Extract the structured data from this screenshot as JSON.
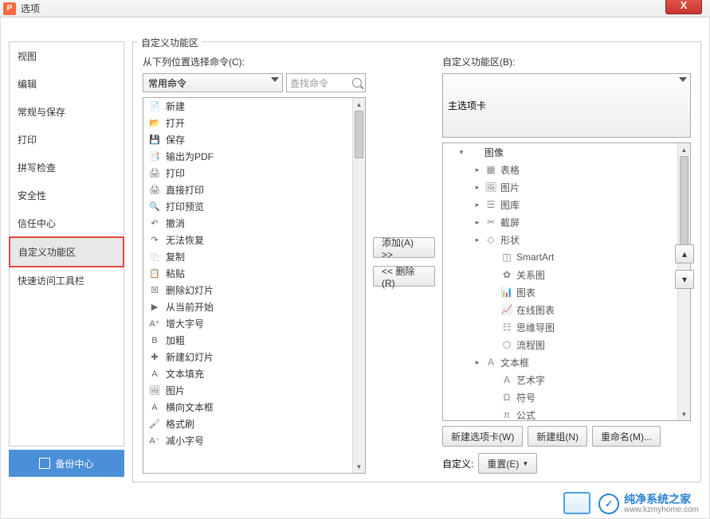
{
  "window": {
    "title": "选项"
  },
  "sidebar": {
    "items": [
      "视图",
      "编辑",
      "常规与保存",
      "打印",
      "拼写检查",
      "安全性",
      "信任中心",
      "自定义功能区",
      "快速访问工具栏"
    ],
    "active_index": 7,
    "backup_label": "备份中心"
  },
  "main": {
    "legend": "自定义功能区",
    "left": {
      "label": "从下列位置选择命令(C):",
      "dropdown": "常用命令",
      "search_placeholder": "查找命令",
      "commands": [
        {
          "icon": "📄",
          "label": "新建"
        },
        {
          "icon": "📂",
          "label": "打开"
        },
        {
          "icon": "💾",
          "label": "保存"
        },
        {
          "icon": "📑",
          "label": "输出为PDF"
        },
        {
          "icon": "🖨",
          "label": "打印"
        },
        {
          "icon": "🖨",
          "label": "直接打印"
        },
        {
          "icon": "🔍",
          "label": "打印预览"
        },
        {
          "icon": "↶",
          "label": "撤消",
          "expand": true
        },
        {
          "icon": "↷",
          "label": "无法恢复"
        },
        {
          "icon": "⿻",
          "label": "复制"
        },
        {
          "icon": "📋",
          "label": "粘贴",
          "expand": true
        },
        {
          "icon": "☒",
          "label": "删除幻灯片"
        },
        {
          "icon": "▶",
          "label": "从当前开始"
        },
        {
          "icon": "A⁺",
          "label": "增大字号"
        },
        {
          "icon": "B",
          "label": "加粗"
        },
        {
          "icon": "✚",
          "label": "新建幻灯片",
          "expand": true
        },
        {
          "icon": "A",
          "label": "文本填充",
          "expand": true
        },
        {
          "icon": "🖼",
          "label": "图片",
          "expand": true
        },
        {
          "icon": "A",
          "label": "横向文本框"
        },
        {
          "icon": "🖌",
          "label": "格式刷"
        },
        {
          "icon": "A⁻",
          "label": "减小字号"
        }
      ]
    },
    "mid": {
      "add_label": "添加(A) >>",
      "remove_label": "<< 删除(R)"
    },
    "right": {
      "label": "自定义功能区(B):",
      "dropdown": "主选项卡",
      "tree": [
        {
          "level": 0,
          "tri": "▾",
          "icon": "",
          "label": "图像"
        },
        {
          "level": 1,
          "tri": "▸",
          "icon": "▦",
          "label": "表格",
          "expand": true
        },
        {
          "level": 1,
          "tri": "▸",
          "icon": "🖼",
          "label": "图片",
          "expand": true
        },
        {
          "level": 1,
          "tri": "▸",
          "icon": "☰",
          "label": "图库",
          "expand": true
        },
        {
          "level": 1,
          "tri": "▸",
          "icon": "✂",
          "label": "截屏",
          "expand": true
        },
        {
          "level": 1,
          "tri": "▸",
          "icon": "◇",
          "label": "形状",
          "expand": true
        },
        {
          "level": 2,
          "tri": "",
          "icon": "◫",
          "label": "SmartArt"
        },
        {
          "level": 2,
          "tri": "",
          "icon": "✿",
          "label": "关系图"
        },
        {
          "level": 2,
          "tri": "",
          "icon": "📊",
          "label": "图表"
        },
        {
          "level": 2,
          "tri": "",
          "icon": "📈",
          "label": "在线图表"
        },
        {
          "level": 2,
          "tri": "",
          "icon": "☷",
          "label": "思维导图"
        },
        {
          "level": 2,
          "tri": "",
          "icon": "⬡",
          "label": "流程图"
        },
        {
          "level": 1,
          "tri": "▸",
          "icon": "A",
          "label": "文本框",
          "expand": true
        },
        {
          "level": 2,
          "tri": "",
          "icon": "A",
          "label": "艺术字"
        },
        {
          "level": 2,
          "tri": "",
          "icon": "Ω",
          "label": "符号",
          "expand": true
        },
        {
          "level": 2,
          "tri": "",
          "icon": "π",
          "label": "公式"
        }
      ],
      "btn_new_tab": "新建选项卡(W)",
      "btn_new_group": "新建组(N)",
      "btn_rename": "重命名(M)...",
      "custom_label": "自定义:",
      "reset_label": "重置(E)"
    }
  },
  "watermark": {
    "brand": "纯净系统之家",
    "domain": "www.kzmyhome.com"
  }
}
